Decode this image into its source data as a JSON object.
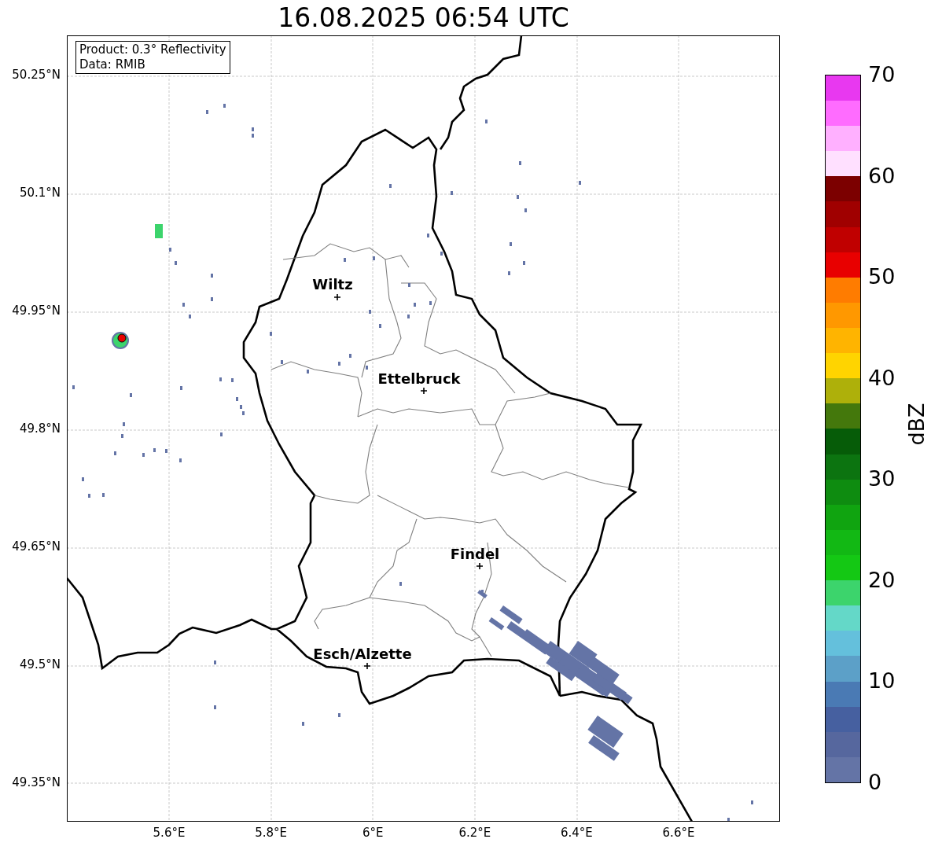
{
  "title": "16.08.2025 06:54 UTC",
  "info_box": [
    "Product: 0.3° Reflectivity",
    "Data: RMIB"
  ],
  "cities": [
    {
      "name": "Wiltz"
    },
    {
      "name": "Ettelbruck"
    },
    {
      "name": "Findel"
    },
    {
      "name": "Esch/Alzette"
    }
  ],
  "y_ticks": [
    "50.25°N",
    "50.1°N",
    "49.95°N",
    "49.8°N",
    "49.65°N",
    "49.5°N",
    "49.35°N"
  ],
  "x_ticks": [
    "5.6°E",
    "5.8°E",
    "6°E",
    "6.2°E",
    "6.4°E",
    "6.6°E"
  ],
  "colorbar": {
    "label": "dBZ",
    "ticks": [
      "70",
      "60",
      "50",
      "40",
      "30",
      "20",
      "10",
      "0"
    ],
    "segments": [
      {
        "color": "#6474a6"
      },
      {
        "color": "#56679e"
      },
      {
        "color": "#4660a0"
      },
      {
        "color": "#4a7ab4"
      },
      {
        "color": "#5ca0c8"
      },
      {
        "color": "#64c0dc"
      },
      {
        "color": "#64d8c8"
      },
      {
        "color": "#3cd46c"
      },
      {
        "color": "#14c814"
      },
      {
        "color": "#12b814"
      },
      {
        "color": "#10a410"
      },
      {
        "color": "#0e8c10"
      },
      {
        "color": "#0c7410"
      },
      {
        "color": "#065c08"
      },
      {
        "color": "#44780c"
      },
      {
        "color": "#aeb00a"
      },
      {
        "color": "#ffd400"
      },
      {
        "color": "#ffb400"
      },
      {
        "color": "#ff9800"
      },
      {
        "color": "#ff7c00"
      },
      {
        "color": "#e80000"
      },
      {
        "color": "#c00000"
      },
      {
        "color": "#a00000"
      },
      {
        "color": "#7c0000"
      },
      {
        "color": "#ffe0ff"
      },
      {
        "color": "#ffb0ff"
      },
      {
        "color": "#ff6cff"
      },
      {
        "color": "#e838f0"
      }
    ]
  }
}
